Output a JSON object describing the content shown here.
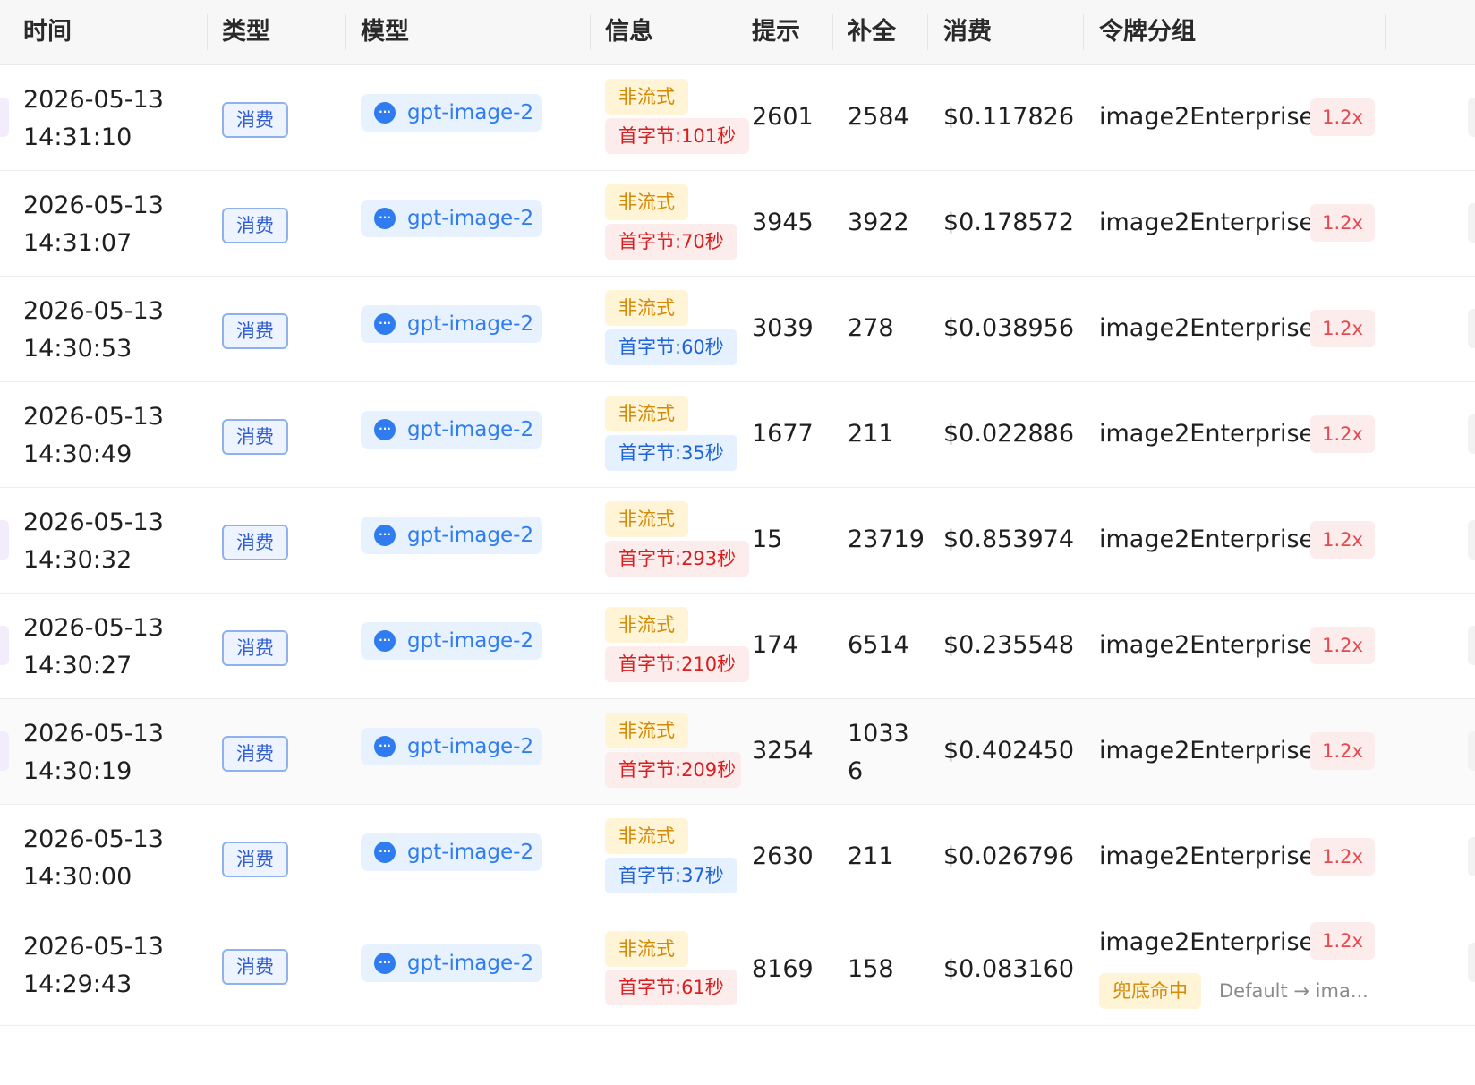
{
  "columns": [
    "时间",
    "类型",
    "模型",
    "信息",
    "提示",
    "补全",
    "消费",
    "令牌分组"
  ],
  "rows": [
    {
      "date": "2026-05-13",
      "time": "14:31:10",
      "type": "消费",
      "model": "gpt-image-2",
      "mode": "非流式",
      "first_byte": "首字节:101秒",
      "first_byte_color": "red",
      "prompt": "2601",
      "completion": "2584",
      "cost": "$0.117826",
      "group": "image2Enterprise",
      "ratio": "1.2x"
    },
    {
      "date": "2026-05-13",
      "time": "14:31:07",
      "type": "消费",
      "model": "gpt-image-2",
      "mode": "非流式",
      "first_byte": "首字节:70秒",
      "first_byte_color": "red",
      "prompt": "3945",
      "completion": "3922",
      "cost": "$0.178572",
      "group": "image2Enterprise",
      "ratio": "1.2x"
    },
    {
      "date": "2026-05-13",
      "time": "14:30:53",
      "type": "消费",
      "model": "gpt-image-2",
      "mode": "非流式",
      "first_byte": "首字节:60秒",
      "first_byte_color": "blue",
      "prompt": "3039",
      "completion": "278",
      "cost": "$0.038956",
      "group": "image2Enterprise",
      "ratio": "1.2x"
    },
    {
      "date": "2026-05-13",
      "time": "14:30:49",
      "type": "消费",
      "model": "gpt-image-2",
      "mode": "非流式",
      "first_byte": "首字节:35秒",
      "first_byte_color": "blue",
      "prompt": "1677",
      "completion": "211",
      "cost": "$0.022886",
      "group": "image2Enterprise",
      "ratio": "1.2x"
    },
    {
      "date": "2026-05-13",
      "time": "14:30:32",
      "type": "消费",
      "model": "gpt-image-2",
      "mode": "非流式",
      "first_byte": "首字节:293秒",
      "first_byte_color": "red",
      "prompt": "15",
      "completion": "23719",
      "cost": "$0.853974",
      "group": "image2Enterprise",
      "ratio": "1.2x"
    },
    {
      "date": "2026-05-13",
      "time": "14:30:27",
      "type": "消费",
      "model": "gpt-image-2",
      "mode": "非流式",
      "first_byte": "首字节:210秒",
      "first_byte_color": "red",
      "prompt": "174",
      "completion": "6514",
      "cost": "$0.235548",
      "group": "image2Enterprise",
      "ratio": "1.2x"
    },
    {
      "date": "2026-05-13",
      "time": "14:30:19",
      "type": "消费",
      "model": "gpt-image-2",
      "mode": "非流式",
      "first_byte": "首字节:209秒",
      "first_byte_color": "red",
      "prompt": "3254",
      "completion_line1": "1033",
      "completion_line2": "6",
      "cost": "$0.402450",
      "group": "image2Enterprise",
      "ratio": "1.2x"
    },
    {
      "date": "2026-05-13",
      "time": "14:30:00",
      "type": "消费",
      "model": "gpt-image-2",
      "mode": "非流式",
      "first_byte": "首字节:37秒",
      "first_byte_color": "blue",
      "prompt": "2630",
      "completion": "211",
      "cost": "$0.026796",
      "group": "image2Enterprise",
      "ratio": "1.2x"
    },
    {
      "date": "2026-05-13",
      "time": "14:29:43",
      "type": "消费",
      "model": "gpt-image-2",
      "mode": "非流式",
      "first_byte": "首字节:61秒",
      "first_byte_color": "red",
      "prompt": "8169",
      "completion": "158",
      "cost": "$0.083160",
      "group": "image2Enterprise",
      "ratio": "1.2x",
      "fallback_tag": "兜底命中",
      "fallback_route": "Default → ima..."
    }
  ],
  "icons": {
    "model_icon": "chat-bubble-icon",
    "model_icon_glyph": "···"
  },
  "colors": {
    "tag_red_bg": "#fdecec",
    "tag_red_text": "#d81e1e",
    "tag_blue_bg": "#e6f1ff",
    "tag_blue_text": "#1f63d6",
    "tag_orange_bg": "#fff4d6",
    "tag_orange_text": "#d48a06",
    "model_text": "#2f7cf0"
  }
}
